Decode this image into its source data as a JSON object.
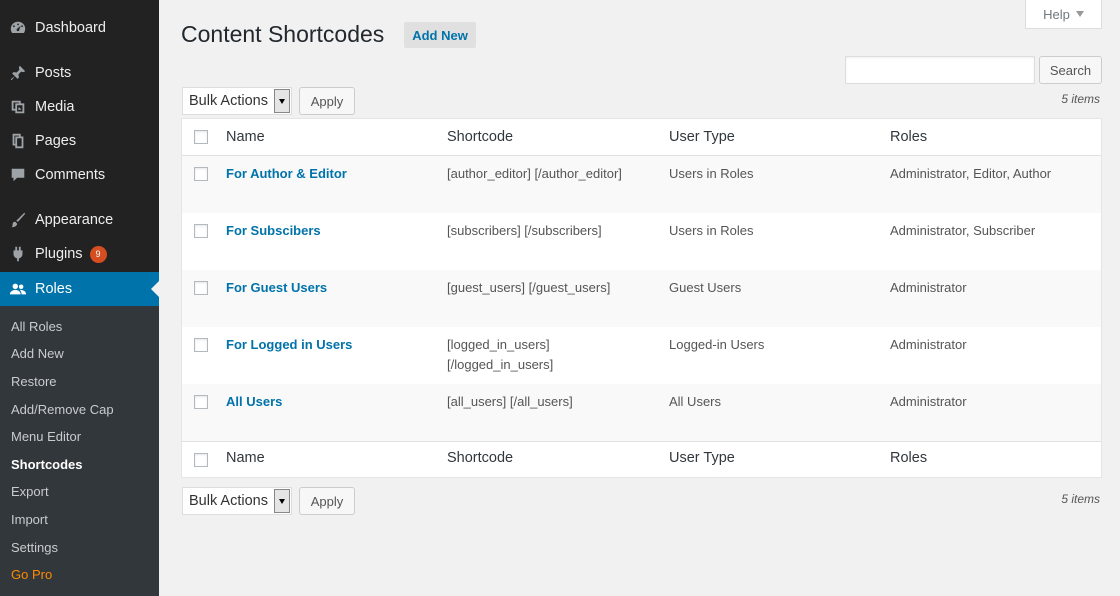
{
  "sidebar": {
    "menu": [
      {
        "label": "Dashboard",
        "icon": "dashboard-icon"
      },
      {
        "label": "Posts",
        "icon": "pin-icon"
      },
      {
        "label": "Media",
        "icon": "media-icon"
      },
      {
        "label": "Pages",
        "icon": "pages-icon"
      },
      {
        "label": "Comments",
        "icon": "comment-icon"
      },
      {
        "label": "Appearance",
        "icon": "brush-icon"
      },
      {
        "label": "Plugins",
        "icon": "plugin-icon",
        "badge": "9"
      },
      {
        "label": "Roles",
        "icon": "users-icon",
        "current": true
      }
    ],
    "submenu": [
      {
        "label": "All Roles"
      },
      {
        "label": "Add New"
      },
      {
        "label": "Restore"
      },
      {
        "label": "Add/Remove Cap"
      },
      {
        "label": "Menu Editor"
      },
      {
        "label": "Shortcodes",
        "current": true
      },
      {
        "label": "Export"
      },
      {
        "label": "Import"
      },
      {
        "label": "Settings"
      },
      {
        "label": "Go Pro"
      }
    ]
  },
  "header": {
    "title": "Content Shortcodes",
    "add_new": "Add New",
    "help": "Help"
  },
  "search": {
    "value": "",
    "button": "Search"
  },
  "tablenav": {
    "bulk_actions": "Bulk Actions",
    "apply": "Apply",
    "items_count": "5 items"
  },
  "table": {
    "columns": [
      "Name",
      "Shortcode",
      "User Type",
      "Roles"
    ],
    "rows": [
      {
        "name": "For Author & Editor",
        "shortcode": "[author_editor] [/author_editor]",
        "user_type": "Users in Roles",
        "roles": "Administrator, Editor, Author"
      },
      {
        "name": "For Subscibers",
        "shortcode": "[subscribers] [/subscribers]",
        "user_type": "Users in Roles",
        "roles": "Administrator, Subscriber"
      },
      {
        "name": "For Guest Users",
        "shortcode": "[guest_users] [/guest_users]",
        "user_type": "Guest Users",
        "roles": "Administrator"
      },
      {
        "name": "For Logged in Users",
        "shortcode": "[logged_in_users] [/logged_in_users]",
        "user_type": "Logged-in Users",
        "roles": "Administrator"
      },
      {
        "name": "All Users",
        "shortcode": "[all_users] [/all_users]",
        "user_type": "All Users",
        "roles": "Administrator"
      }
    ]
  },
  "colors": {
    "sidebar_bg": "#222222",
    "submenu_bg": "#32373c",
    "accent": "#0073aa",
    "badge": "#d54e21",
    "go_pro": "#ff8a00"
  }
}
